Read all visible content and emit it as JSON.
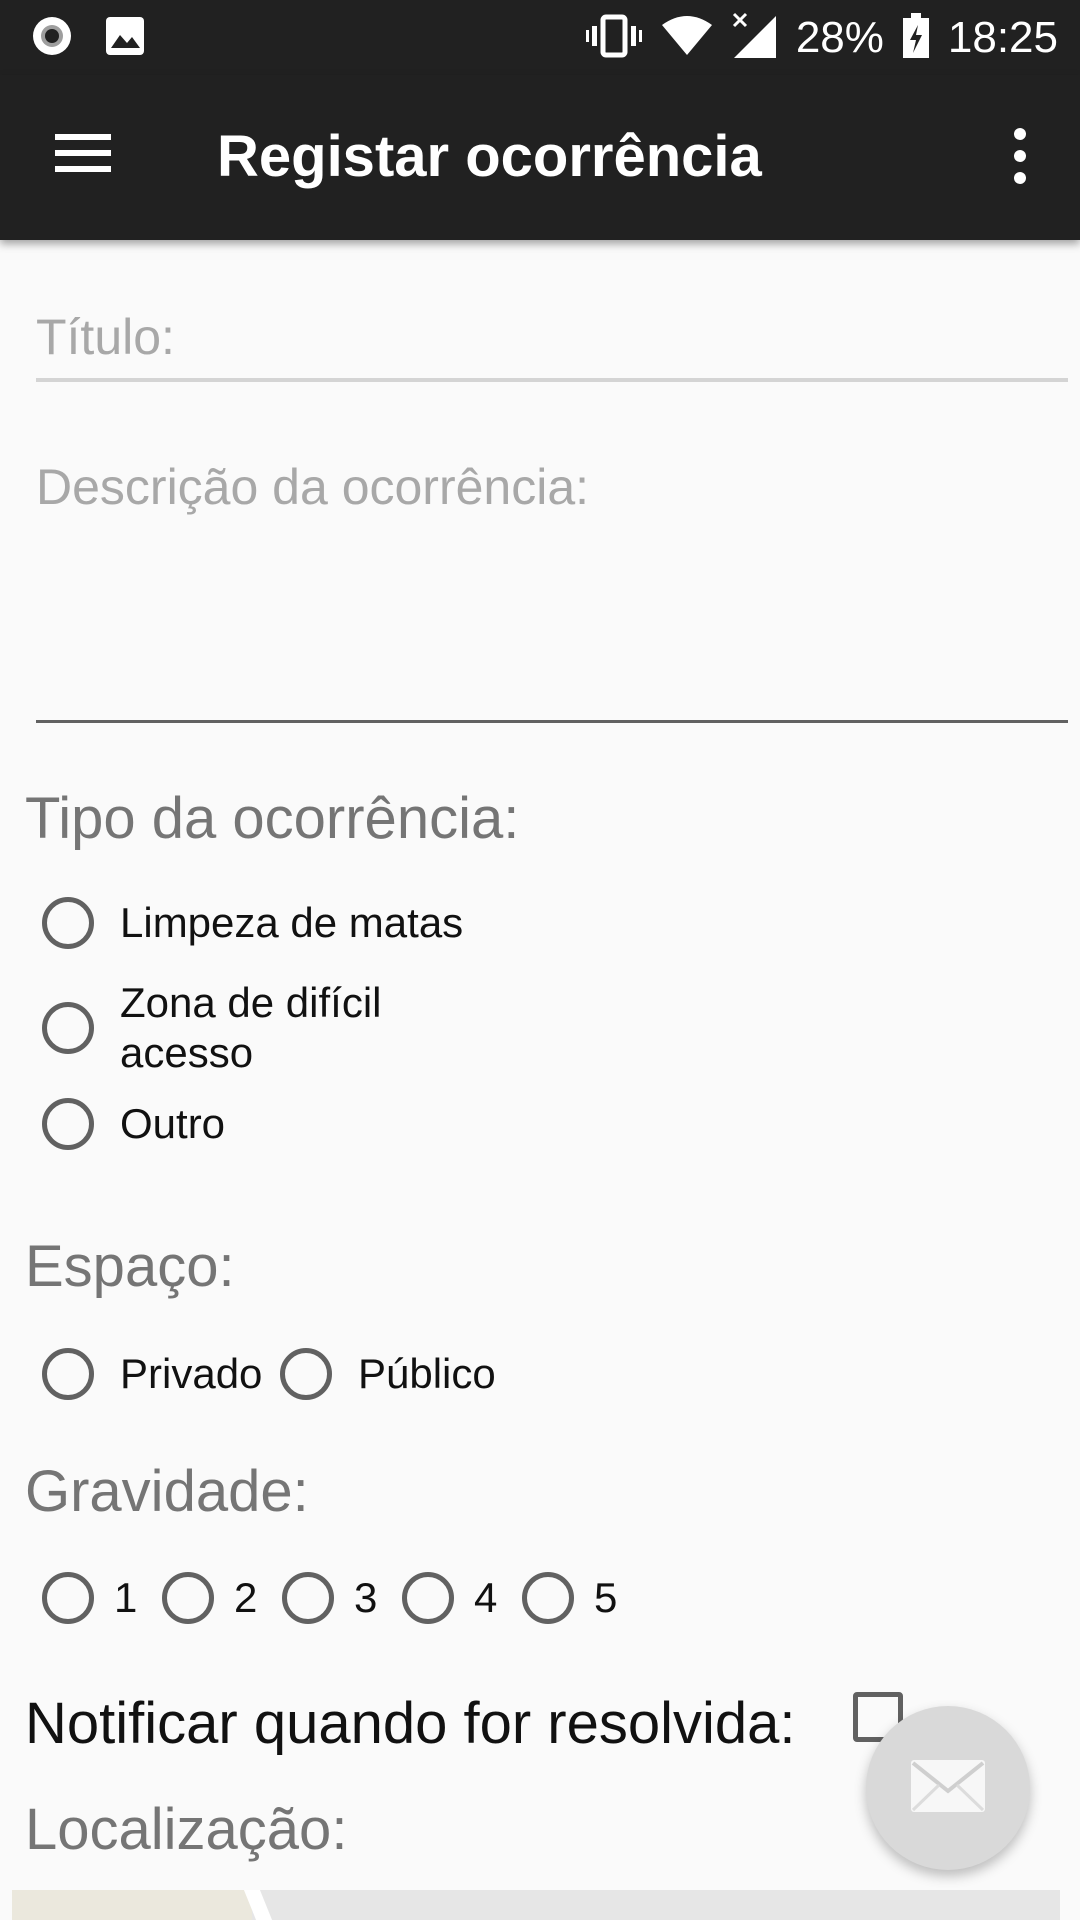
{
  "status_bar": {
    "battery": "28%",
    "time": "18:25",
    "icons": [
      "record-icon",
      "image-icon",
      "vibrate-icon",
      "wifi-icon",
      "signal-icon",
      "battery-charging-icon"
    ]
  },
  "app_bar": {
    "title": "Registar ocorrência",
    "menu_icon": "hamburger-menu-icon",
    "overflow_icon": "overflow-menu-icon"
  },
  "form": {
    "title_placeholder": "Título:",
    "description_placeholder": "Descrição da ocorrência:",
    "type": {
      "label": "Tipo da ocorrência:",
      "options": [
        "Limpeza de matas",
        "Zona de difícil acesso",
        "Outro"
      ]
    },
    "space": {
      "label": "Espaço:",
      "options": [
        "Privado",
        "Público"
      ]
    },
    "severity": {
      "label": "Gravidade:",
      "options": [
        "1",
        "2",
        "3",
        "4",
        "5"
      ]
    },
    "notify_label": "Notificar quando for resolvida:",
    "location_label": "Localização:"
  },
  "fab": {
    "icon": "mail-icon"
  },
  "colors": {
    "toolbar": "#212121",
    "background": "#fafafa",
    "hint": "#a8a8a8",
    "label": "#757575",
    "fab": "#d9d9d9"
  }
}
